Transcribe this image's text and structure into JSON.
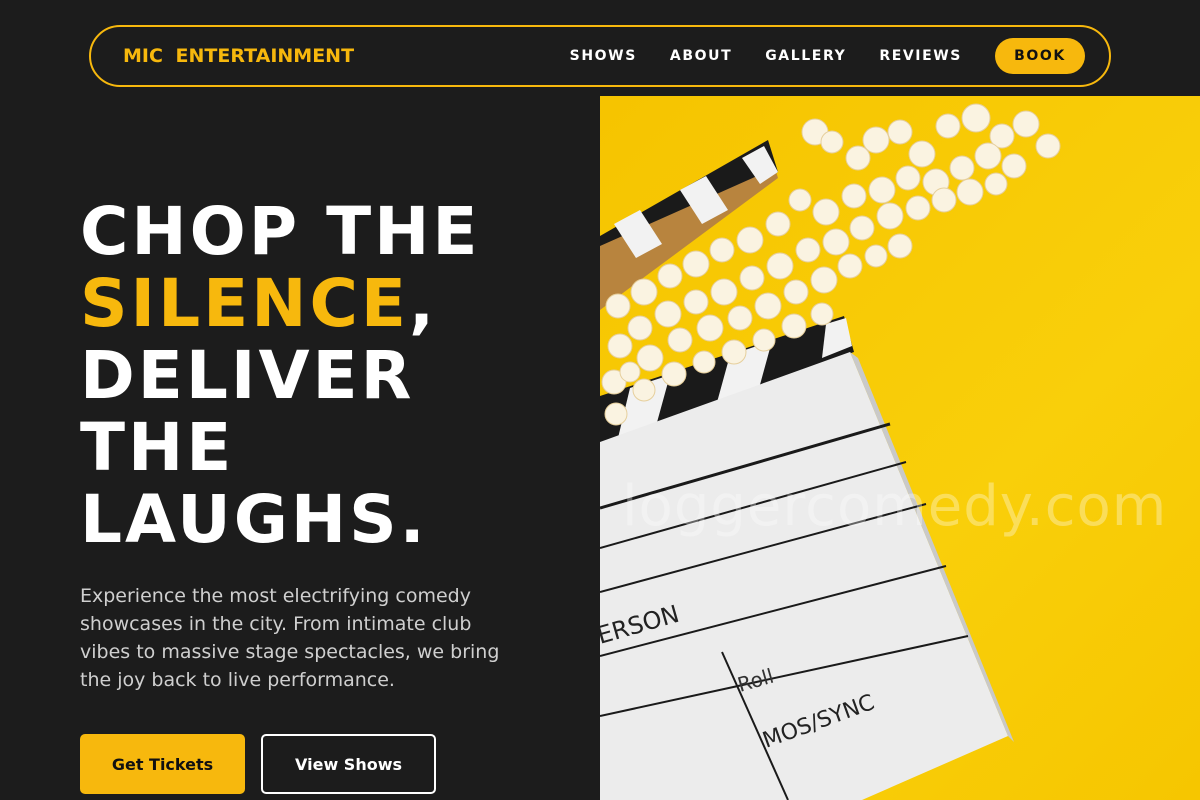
{
  "nav": {
    "brand": "MIC  ENTERTAINMENT",
    "links": [
      "SHOWS",
      "ABOUT",
      "GALLERY",
      "REVIEWS"
    ],
    "book_label": "BOOK"
  },
  "hero": {
    "headline_1": "CHOP THE",
    "headline_highlight": "SILENCE",
    "headline_comma": ",",
    "headline_2": "DELIVER",
    "headline_3": "THE",
    "headline_4": "LAUGHS.",
    "description": "Experience the most electrifying comedy showcases in the city. From intimate club vibes to massive stage spectacles, we bring the joy back to live performance.",
    "primary_button": "Get Tickets",
    "secondary_button": "View Shows"
  },
  "image": {
    "watermark": "loggercomedy.com",
    "clapper_text_1": "ERSON",
    "clapper_text_2": "Roll",
    "clapper_text_3": "MOS/SYNC"
  },
  "colors": {
    "accent": "#f7b80d",
    "background": "#1c1c1c",
    "image_bg": "#f9cc06"
  }
}
